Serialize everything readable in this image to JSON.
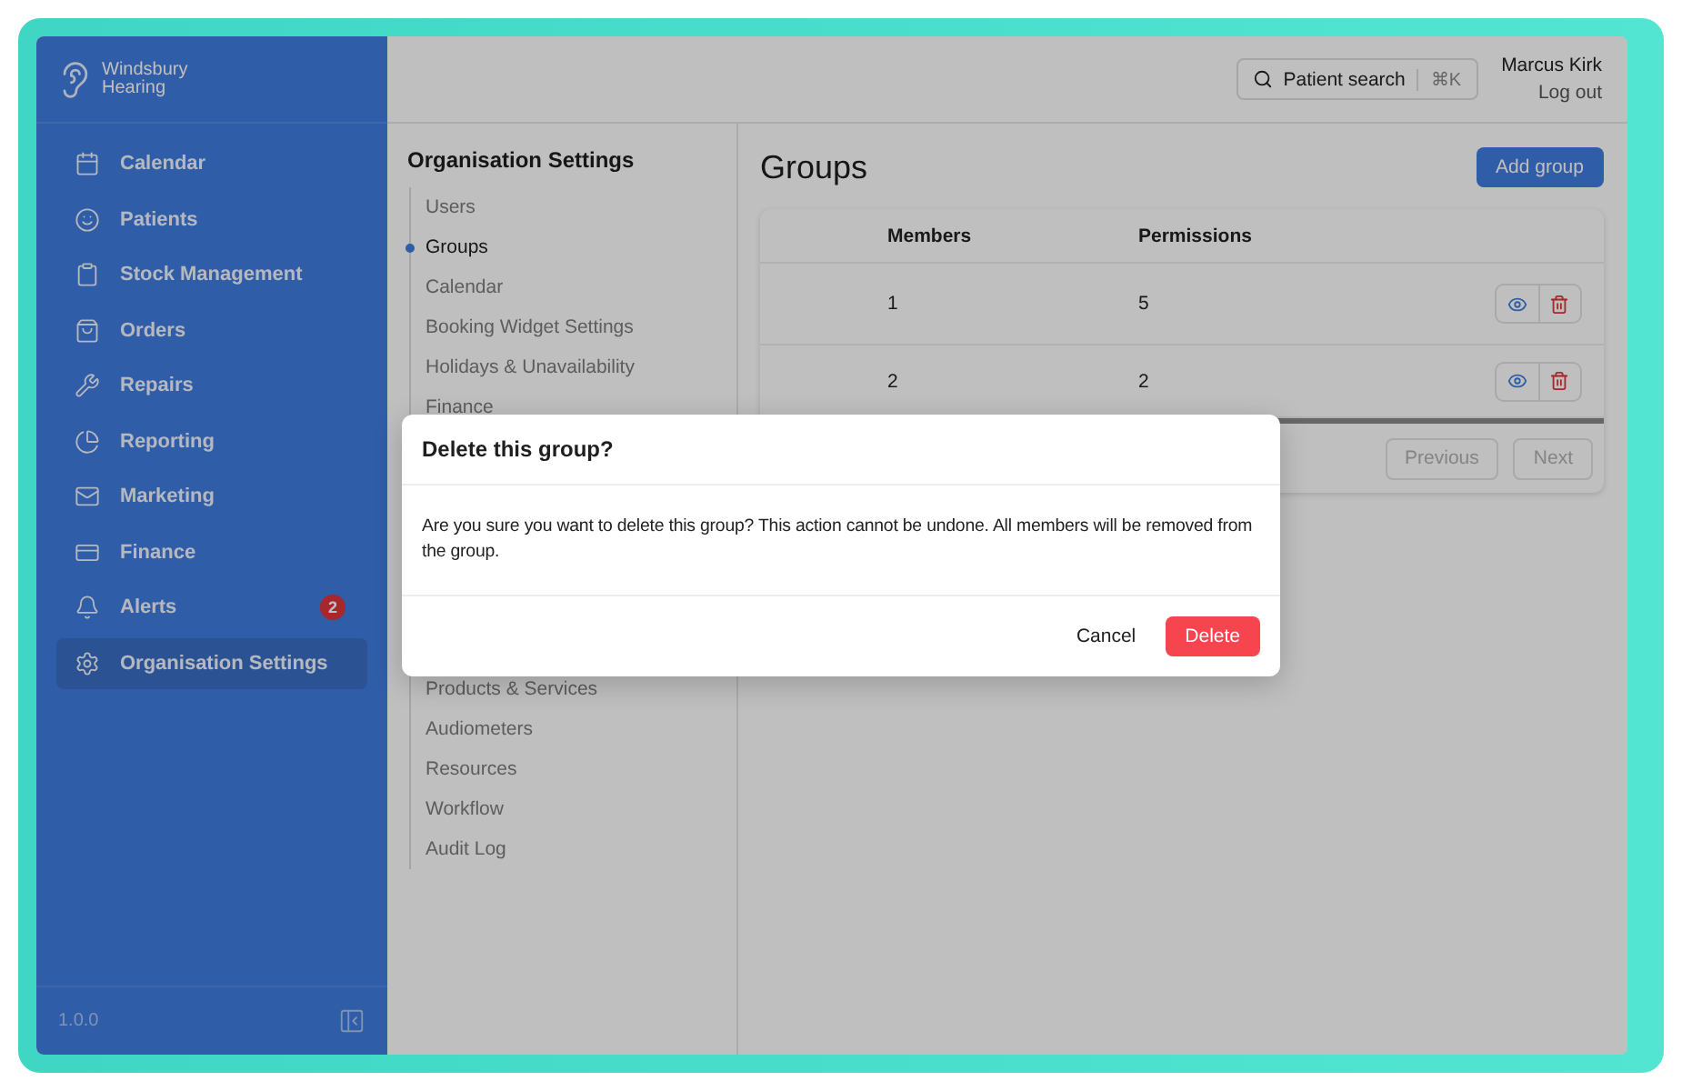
{
  "brand": {
    "line_1": "Windsbury",
    "line_2": "Hearing"
  },
  "sidebar": {
    "items": [
      {
        "label": "Calendar",
        "selected": false
      },
      {
        "label": "Patients",
        "selected": false
      },
      {
        "label": "Stock Management",
        "selected": false
      },
      {
        "label": "Orders",
        "selected": false
      },
      {
        "label": "Repairs",
        "selected": false
      },
      {
        "label": "Reporting",
        "selected": false
      },
      {
        "label": "Marketing",
        "selected": false
      },
      {
        "label": "Finance",
        "selected": false
      },
      {
        "label": "Alerts",
        "selected": false,
        "badge": "2"
      },
      {
        "label": "Organisation Settings",
        "selected": true
      }
    ],
    "version": "1.0.0"
  },
  "topbar": {
    "search_label": "Patient search",
    "shortcut": "⌘K",
    "user_name": "Marcus Kirk",
    "logout": "Log out"
  },
  "settings_nav": {
    "title": "Organisation Settings",
    "items_above": [
      {
        "label": "Users",
        "selected": false
      },
      {
        "label": "Groups",
        "selected": true
      },
      {
        "label": "Calendar",
        "selected": false
      },
      {
        "label": "Booking Widget Settings",
        "selected": false
      },
      {
        "label": "Holidays & Unavailability",
        "selected": false
      },
      {
        "label": "Finance",
        "selected": false
      }
    ],
    "items_below": [
      {
        "label": "Products & Services",
        "selected": false
      },
      {
        "label": "Audiometers",
        "selected": false
      },
      {
        "label": "Resources",
        "selected": false
      },
      {
        "label": "Workflow",
        "selected": false
      },
      {
        "label": "Audit Log",
        "selected": false
      }
    ]
  },
  "page": {
    "title": "Groups",
    "add_button": "Add group"
  },
  "table": {
    "columns": [
      "Members",
      "Permissions"
    ],
    "rows": [
      {
        "members": "1",
        "permissions": "5"
      },
      {
        "members": "2",
        "permissions": "2"
      }
    ],
    "pagination": [
      {
        "label": "Previous",
        "disabled": true
      },
      {
        "label": "Next",
        "disabled": true
      }
    ]
  },
  "dialog": {
    "title": "Delete this group?",
    "message": "Are you sure you want to delete this group? This action cannot be undone. All members will be removed from the group.",
    "cancel": "Cancel",
    "confirm": "Delete"
  }
}
